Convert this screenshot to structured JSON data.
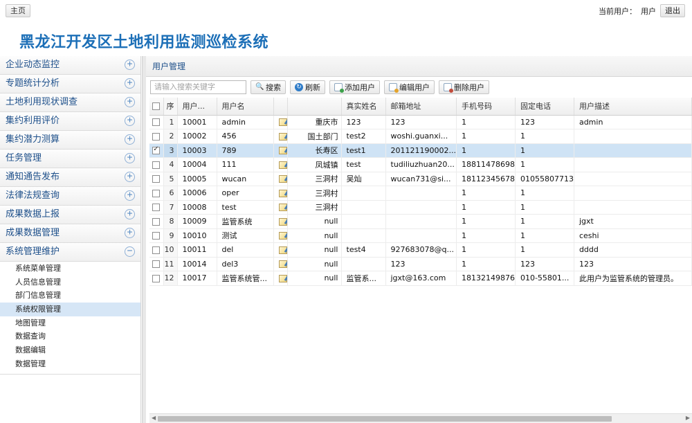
{
  "header": {
    "home_label": "主页",
    "current_user_label": "当前用户：",
    "current_user": "用户",
    "logout_label": "退出"
  },
  "app_title": "黑龙江开发区土地利用监测巡检系统",
  "sidebar": {
    "items": [
      {
        "label": "企业动态监控",
        "toggle": "+"
      },
      {
        "label": "专题统计分析",
        "toggle": "+"
      },
      {
        "label": "土地利用现状调查",
        "toggle": "+"
      },
      {
        "label": "集约利用评价",
        "toggle": "+"
      },
      {
        "label": "集约潜力测算",
        "toggle": "+"
      },
      {
        "label": "任务管理",
        "toggle": "+"
      },
      {
        "label": "通知通告发布",
        "toggle": "+"
      },
      {
        "label": "法律法规查询",
        "toggle": "+"
      },
      {
        "label": "成果数据上报",
        "toggle": "+"
      },
      {
        "label": "成果数据管理",
        "toggle": "+"
      },
      {
        "label": "系统管理维护",
        "toggle": "−"
      }
    ],
    "subitems": [
      {
        "label": "系统菜单管理",
        "active": false
      },
      {
        "label": "人员信息管理",
        "active": false
      },
      {
        "label": "部门信息管理",
        "active": false
      },
      {
        "label": "系统权限管理",
        "active": true
      },
      {
        "label": "地图管理",
        "active": false
      },
      {
        "label": "数据查询",
        "active": false
      },
      {
        "label": "数据编辑",
        "active": false
      },
      {
        "label": "数据管理",
        "active": false
      }
    ]
  },
  "panel": {
    "title": "用户管理",
    "search_placeholder": "请输入搜索关键字",
    "buttons": {
      "search": "搜索",
      "refresh": "刷新",
      "add": "添加用户",
      "edit": "编辑用户",
      "delete": "删除用户"
    }
  },
  "table": {
    "columns": [
      "序",
      "用户...",
      "用户名",
      "",
      "",
      "真实姓名",
      "邮箱地址",
      "手机号码",
      "固定电话",
      "用户描述"
    ],
    "rows": [
      {
        "n": "1",
        "id": "10001",
        "username": "admin",
        "region": "重庆市",
        "realname": "123",
        "email": "123",
        "mobile": "1",
        "phone": "123",
        "desc": "admin",
        "checked": false,
        "selected": false
      },
      {
        "n": "2",
        "id": "10002",
        "username": "456",
        "region": "国土部门",
        "realname": "test2",
        "email": "woshi.guanxi...",
        "mobile": "1",
        "phone": "1",
        "desc": "",
        "checked": false,
        "selected": false
      },
      {
        "n": "3",
        "id": "10003",
        "username": "789",
        "region": "长寿区",
        "realname": "test1",
        "email": "201121190002...",
        "mobile": "1",
        "phone": "1",
        "desc": "",
        "checked": true,
        "selected": true
      },
      {
        "n": "4",
        "id": "10004",
        "username": "111",
        "region": "凤城镇",
        "realname": "test",
        "email": "tudiliuzhuan20...",
        "mobile": "18811478698",
        "phone": "1",
        "desc": "",
        "checked": false,
        "selected": false
      },
      {
        "n": "5",
        "id": "10005",
        "username": "wucan",
        "region": "三洞村",
        "realname": "吴灿",
        "email": "wucan731@si...",
        "mobile": "18112345678",
        "phone": "01055807713",
        "desc": "",
        "checked": false,
        "selected": false
      },
      {
        "n": "6",
        "id": "10006",
        "username": "oper",
        "region": "三洞村",
        "realname": "",
        "email": "",
        "mobile": "1",
        "phone": "1",
        "desc": "",
        "checked": false,
        "selected": false
      },
      {
        "n": "7",
        "id": "10008",
        "username": "test",
        "region": "三洞村",
        "realname": "",
        "email": "",
        "mobile": "1",
        "phone": "1",
        "desc": "",
        "checked": false,
        "selected": false
      },
      {
        "n": "8",
        "id": "10009",
        "username": "监管系统",
        "region": "null",
        "realname": "",
        "email": "",
        "mobile": "1",
        "phone": "1",
        "desc": "jgxt",
        "checked": false,
        "selected": false
      },
      {
        "n": "9",
        "id": "10010",
        "username": "测试",
        "region": "null",
        "realname": "",
        "email": "",
        "mobile": "1",
        "phone": "1",
        "desc": "ceshi",
        "checked": false,
        "selected": false
      },
      {
        "n": "10",
        "id": "10011",
        "username": "del",
        "region": "null",
        "realname": "test4",
        "email": "927683078@q...",
        "mobile": "1",
        "phone": "1",
        "desc": "dddd",
        "checked": false,
        "selected": false
      },
      {
        "n": "11",
        "id": "10014",
        "username": "del3",
        "region": "null",
        "realname": "",
        "email": "123",
        "mobile": "1",
        "phone": "123",
        "desc": "123",
        "checked": false,
        "selected": false
      },
      {
        "n": "12",
        "id": "10017",
        "username": "监管系统管...",
        "region": "null",
        "realname": "监管系...",
        "email": "jgxt@163.com",
        "mobile": "18132149876",
        "phone": "010-55801...",
        "desc": "此用户为监管系统的管理员。",
        "checked": false,
        "selected": false
      }
    ]
  },
  "colors": {
    "title": "#1c6fb7",
    "menu_text": "#1d4f8a",
    "selected_row": "#cfe3f5"
  }
}
